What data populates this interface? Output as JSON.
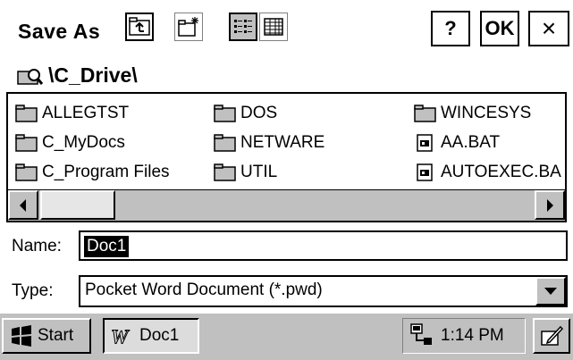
{
  "dialog": {
    "title": "Save As",
    "toolbar": {
      "up_icon": "folder-up-icon",
      "new_folder_icon": "new-folder-icon",
      "list_view_icon": "list-view-icon",
      "details_view_icon": "details-view-icon"
    },
    "help_label": "?",
    "ok_label": "OK",
    "close_label": "×"
  },
  "path": "\\C_Drive\\",
  "files": [
    {
      "name": "ALLEGTST",
      "type": "folder"
    },
    {
      "name": "C_MyDocs",
      "type": "folder"
    },
    {
      "name": "C_Program Files",
      "type": "folder"
    },
    {
      "name": "DOS",
      "type": "folder"
    },
    {
      "name": "NETWARE",
      "type": "folder"
    },
    {
      "name": "UTIL",
      "type": "folder"
    },
    {
      "name": "WINCESYS",
      "type": "folder"
    },
    {
      "name": "AA.BAT",
      "type": "batch"
    },
    {
      "name": "AUTOEXEC.BA",
      "type": "batch"
    }
  ],
  "name_field": {
    "label": "Name:",
    "value": "Doc1"
  },
  "type_field": {
    "label": "Type:",
    "value": "Pocket Word Document (*.pwd)"
  },
  "taskbar": {
    "start_label": "Start",
    "task_label": "Doc1",
    "clock": "1:14 PM"
  },
  "colors": {
    "selection": "#000000",
    "chrome": "#c0c0c0"
  }
}
